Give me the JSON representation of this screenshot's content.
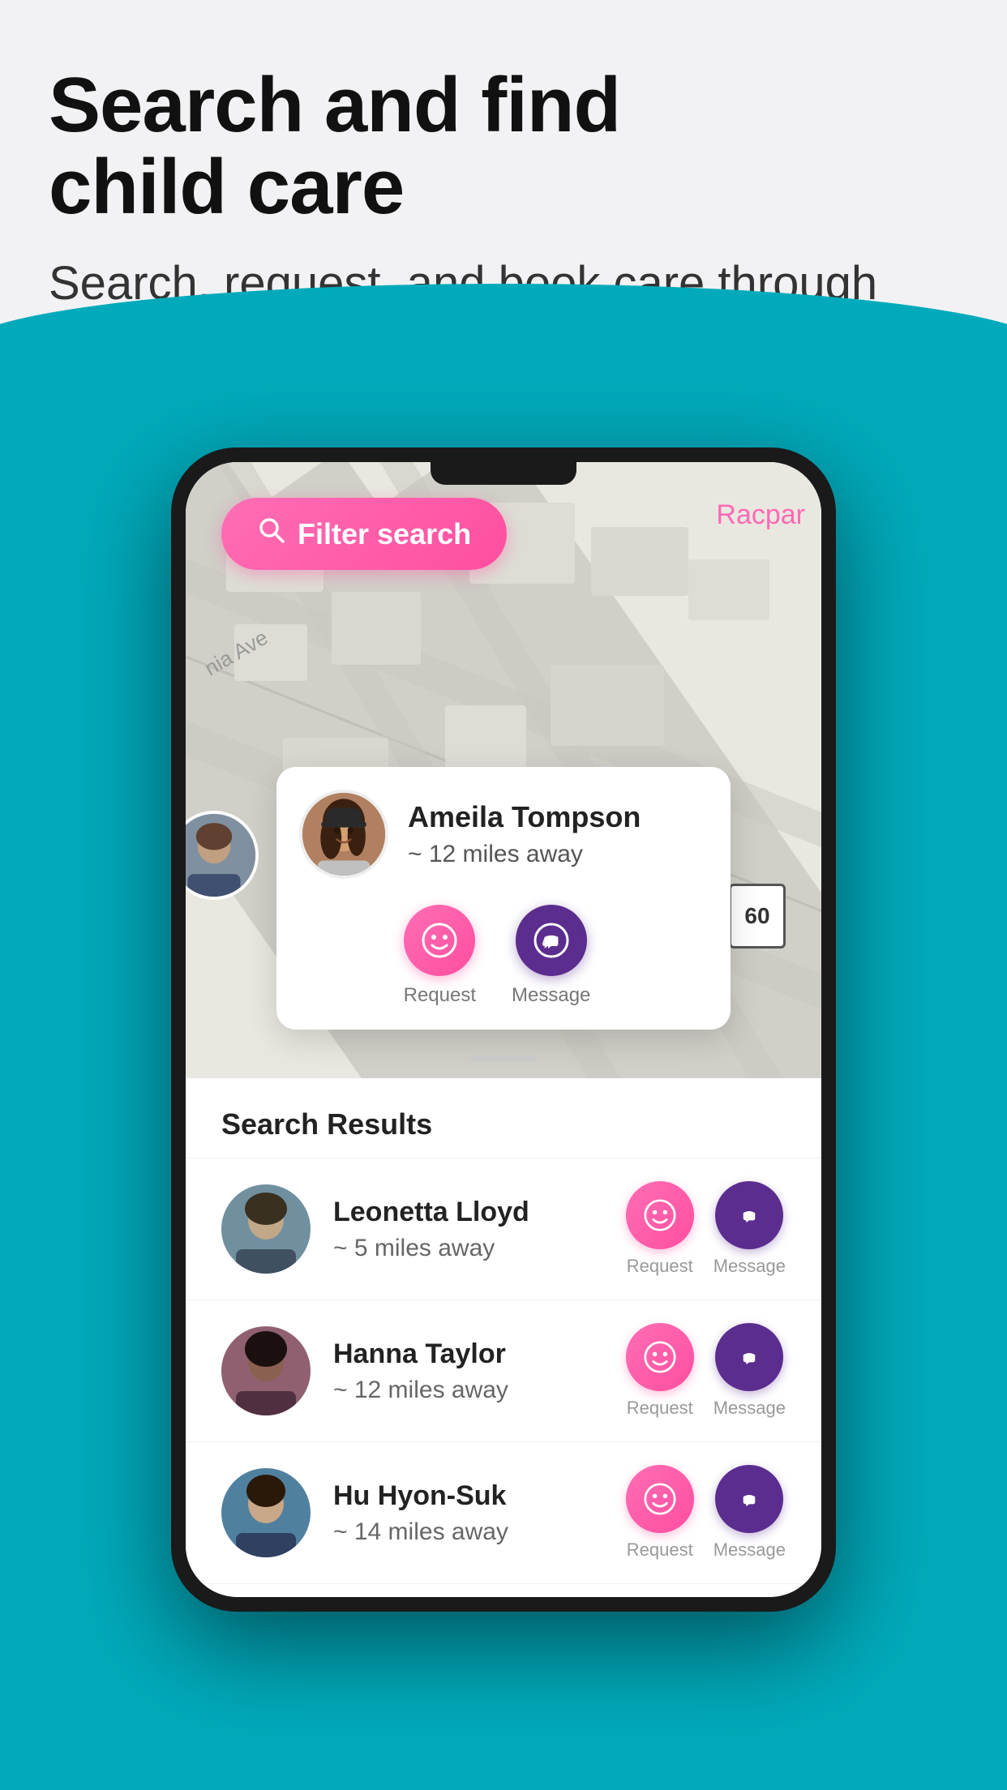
{
  "header": {
    "title_line1": "Search and find",
    "title_line2": "child care",
    "subtitle": "Search, request, and book care through your trusted network."
  },
  "map": {
    "filter_button_label": "Filter search",
    "label_racpar": "Racpar",
    "label_ave": "nia Ave",
    "speed_limit": "60"
  },
  "profile_card": {
    "name": "Ameila Tompson",
    "distance": "~ 12 miles away",
    "request_label": "Request",
    "message_label": "Message"
  },
  "results": {
    "section_title": "Search Results",
    "items": [
      {
        "name": "Leonetta Lloyd",
        "distance": "~ 5 miles away",
        "request_label": "Request",
        "message_label": "Message"
      },
      {
        "name": "Hanna Taylor",
        "distance": "~ 12 miles away",
        "request_label": "Request",
        "message_label": "Message"
      },
      {
        "name": "Hu Hyon-Suk",
        "distance": "~ 14 miles away",
        "request_label": "Request",
        "message_label": "Message"
      }
    ]
  },
  "colors": {
    "pink_gradient_start": "#ff6eb4",
    "pink_gradient_end": "#ff4ea0",
    "purple": "#5b2d8e",
    "teal": "#00aabb"
  }
}
